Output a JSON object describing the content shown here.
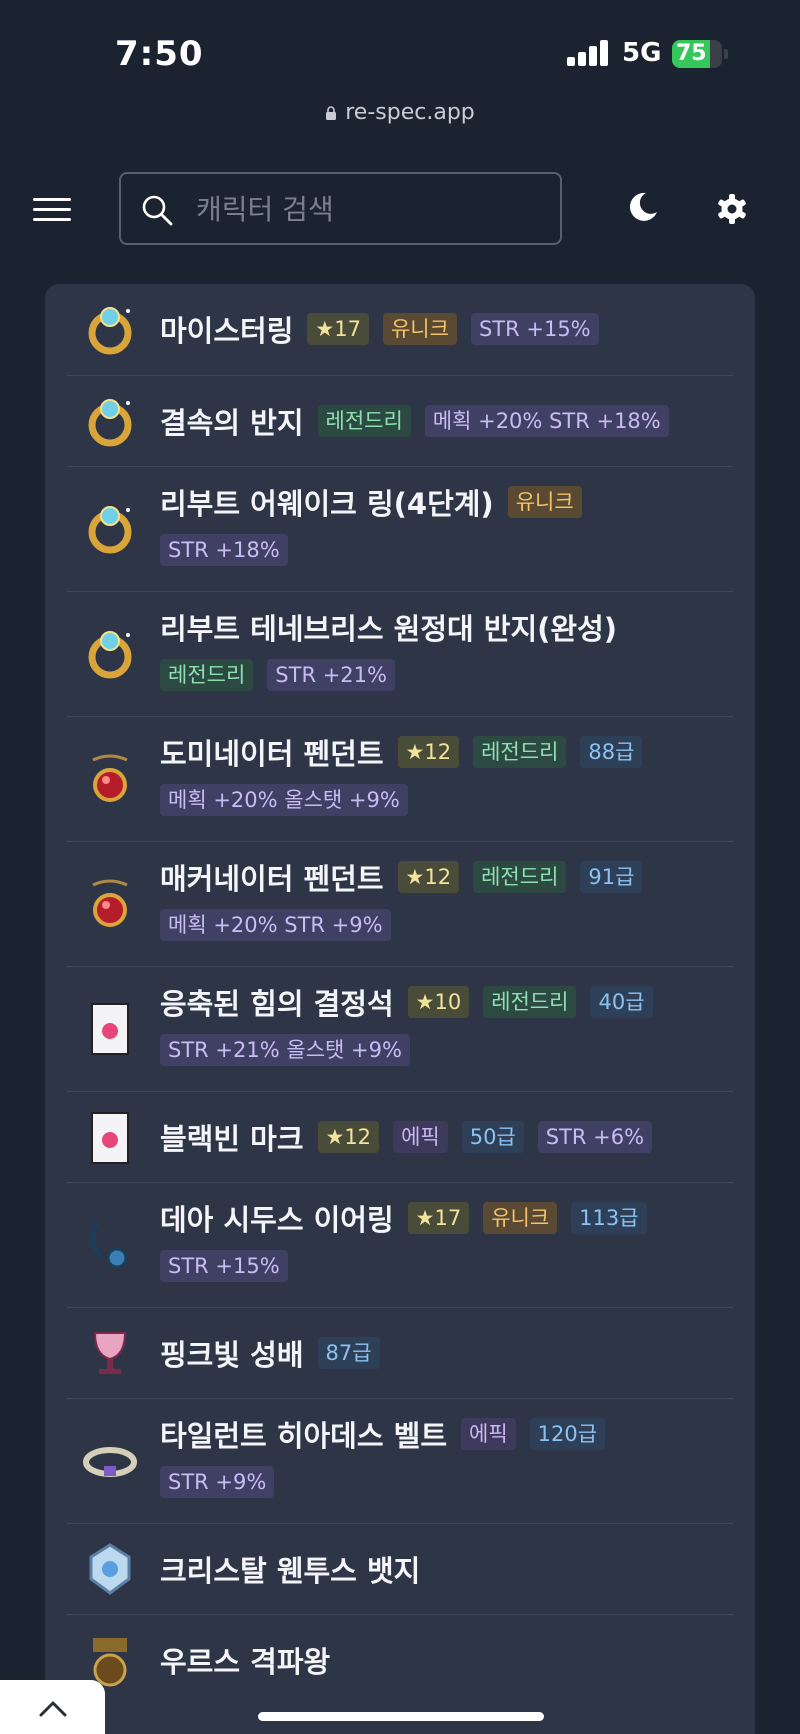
{
  "status": {
    "time": "7:50",
    "network": "5G",
    "battery": "75",
    "battery_level": 0.75
  },
  "url": "re-spec.app",
  "header": {
    "search_placeholder": "캐릭터 검색"
  },
  "items": [
    {
      "name": "마이스터링",
      "icon": "ring-icon",
      "badges": [
        {
          "type": "star",
          "text": "★17"
        },
        {
          "type": "unique",
          "text": "유니크"
        },
        {
          "type": "stat",
          "text": "STR +15%"
        }
      ],
      "wrap": []
    },
    {
      "name": "결속의 반지",
      "icon": "ring-icon",
      "badges": [
        {
          "type": "legend",
          "text": "레전드리"
        },
        {
          "type": "stat",
          "text": "메획 +20% STR +18%"
        }
      ],
      "wrap": []
    },
    {
      "name": "리부트 어웨이크 링(4단계)",
      "icon": "ring-icon",
      "badges": [
        {
          "type": "unique",
          "text": "유니크"
        }
      ],
      "wrap": [
        {
          "type": "stat",
          "text": "STR +18%"
        }
      ]
    },
    {
      "name": "리부트 테네브리스 원정대 반지(완성)",
      "icon": "ring-icon",
      "badges": [],
      "wrap": [
        {
          "type": "legend",
          "text": "레전드리"
        },
        {
          "type": "stat",
          "text": "STR +21%"
        }
      ]
    },
    {
      "name": "도미네이터 펜던트",
      "icon": "pendant-icon",
      "badges": [
        {
          "type": "star",
          "text": "★12"
        },
        {
          "type": "legend",
          "text": "레전드리"
        },
        {
          "type": "level",
          "text": "88급"
        }
      ],
      "wrap": [
        {
          "type": "stat",
          "text": "메획 +20% 올스탯 +9%"
        }
      ]
    },
    {
      "name": "매커네이터 펜던트",
      "icon": "pendant-icon",
      "badges": [
        {
          "type": "star",
          "text": "★12"
        },
        {
          "type": "legend",
          "text": "레전드리"
        },
        {
          "type": "level",
          "text": "91급"
        }
      ],
      "wrap": [
        {
          "type": "stat",
          "text": "메획 +20% STR +9%"
        }
      ]
    },
    {
      "name": "응축된 힘의 결정석",
      "icon": "pocket-icon",
      "badges": [
        {
          "type": "star",
          "text": "★10"
        },
        {
          "type": "legend",
          "text": "레전드리"
        },
        {
          "type": "level",
          "text": "40급"
        }
      ],
      "wrap": [
        {
          "type": "stat",
          "text": "STR +21% 올스탯 +9%"
        }
      ]
    },
    {
      "name": "블랙빈 마크",
      "icon": "pocket-icon",
      "badges": [
        {
          "type": "star",
          "text": "★12"
        },
        {
          "type": "epic",
          "text": "에픽"
        },
        {
          "type": "level",
          "text": "50급"
        },
        {
          "type": "stat",
          "text": "STR +6%"
        }
      ],
      "wrap": []
    },
    {
      "name": "데아 시두스 이어링",
      "icon": "earring-icon",
      "badges": [
        {
          "type": "star",
          "text": "★17"
        },
        {
          "type": "unique",
          "text": "유니크"
        },
        {
          "type": "level",
          "text": "113급"
        }
      ],
      "wrap": [
        {
          "type": "stat",
          "text": "STR +15%"
        }
      ]
    },
    {
      "name": "핑크빛 성배",
      "icon": "chalice-icon",
      "badges": [
        {
          "type": "level",
          "text": "87급"
        }
      ],
      "wrap": []
    },
    {
      "name": "타일런트 히아데스 벨트",
      "icon": "belt-icon",
      "badges": [
        {
          "type": "epic",
          "text": "에픽"
        },
        {
          "type": "level",
          "text": "120급"
        }
      ],
      "wrap": [
        {
          "type": "stat",
          "text": "STR +9%"
        }
      ]
    },
    {
      "name": "크리스탈 웬투스 뱃지",
      "icon": "badge-icon",
      "badges": [],
      "wrap": []
    },
    {
      "name": "우르스 격파왕",
      "icon": "medal-icon",
      "badges": [],
      "wrap": []
    }
  ],
  "scroll_top_icon": "chevron-up-icon"
}
